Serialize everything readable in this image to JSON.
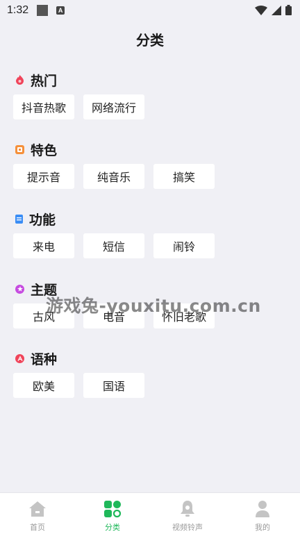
{
  "status_bar": {
    "time": "1:32",
    "notif_letter": "A"
  },
  "page": {
    "title": "分类"
  },
  "sections": [
    {
      "title": "热门",
      "icon": "flame-icon",
      "color": "#f0445a",
      "chips": [
        "抖音热歌",
        "网络流行"
      ]
    },
    {
      "title": "特色",
      "icon": "square-badge-icon",
      "color": "#f5903a",
      "chips": [
        "提示音",
        "纯音乐",
        "搞笑"
      ]
    },
    {
      "title": "功能",
      "icon": "bookmark-icon",
      "color": "#3a8df5",
      "chips": [
        "来电",
        "短信",
        "闹铃"
      ]
    },
    {
      "title": "主题",
      "icon": "star-circle-icon",
      "color": "#c64be0",
      "chips": [
        "古风",
        "电音",
        "怀旧老歌"
      ]
    },
    {
      "title": "语种",
      "icon": "a-circle-icon",
      "color": "#f0445a",
      "chips": [
        "欧美",
        "国语"
      ]
    }
  ],
  "watermark": "游戏兔-youxitu.com.cn",
  "tabbar": {
    "active_color": "#1fb85a",
    "inactive_color": "#c4c4c4",
    "tabs": [
      {
        "label": "首页",
        "icon": "home-icon"
      },
      {
        "label": "分类",
        "icon": "grid-icon"
      },
      {
        "label": "视频铃声",
        "icon": "bell-icon"
      },
      {
        "label": "我的",
        "icon": "user-icon"
      }
    ]
  }
}
